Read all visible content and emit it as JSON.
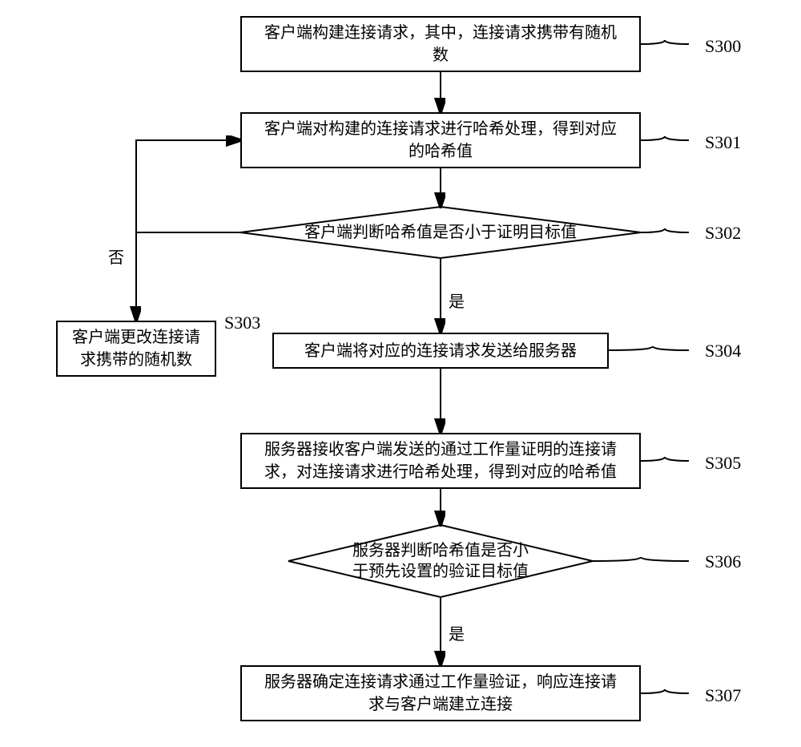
{
  "steps": {
    "s300": {
      "text": "客户端构建连接请求，其中，连接请求携带有随机\n数",
      "label": "S300"
    },
    "s301": {
      "text": "客户端对构建的连接请求进行哈希处理，得到对应\n的哈希值",
      "label": "S301"
    },
    "s302": {
      "text": "客户端判断哈希值是否小于证明目标值",
      "label": "S302"
    },
    "s303": {
      "text": "客户端更改连接请\n求携带的随机数",
      "label": "S303"
    },
    "s304": {
      "text": "客户端将对应的连接请求发送给服务器",
      "label": "S304"
    },
    "s305": {
      "text": "服务器接收客户端发送的通过工作量证明的连接请\n求，对连接请求进行哈希处理，得到对应的哈希值",
      "label": "S305"
    },
    "s306": {
      "text": "服务器判断哈希值是否小\n于预先设置的验证目标值",
      "label": "S306"
    },
    "s307": {
      "text": "服务器确定连接请求通过工作量验证，响应连接请\n求与客户端建立连接",
      "label": "S307"
    }
  },
  "branches": {
    "yes1": "是",
    "no1": "否",
    "yes2": "是"
  }
}
